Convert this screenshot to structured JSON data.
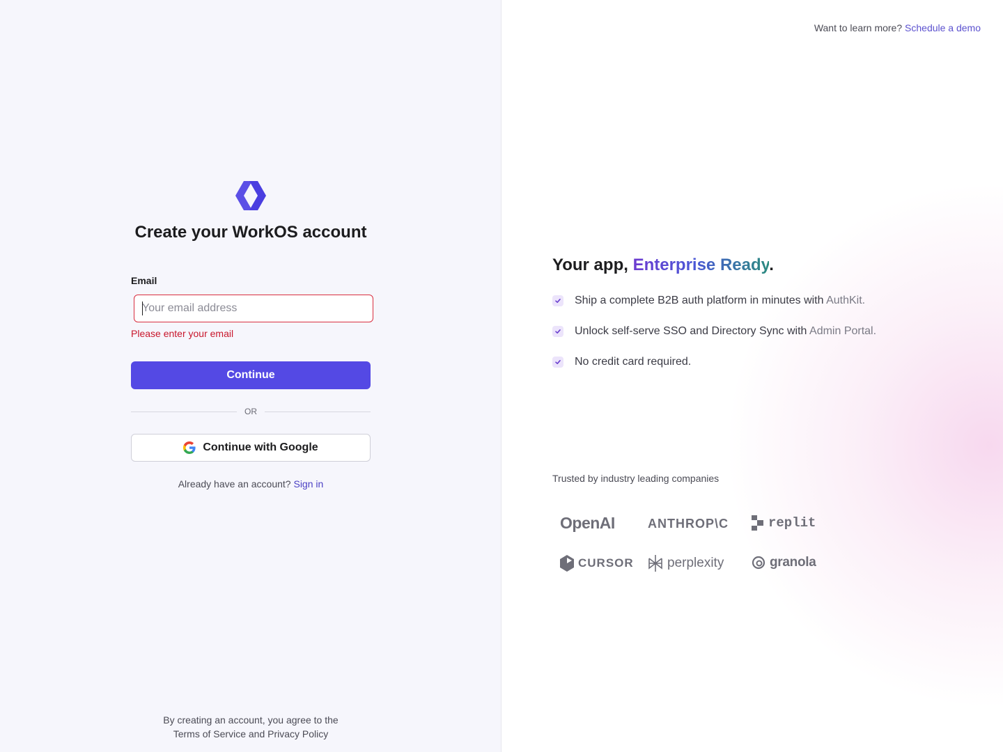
{
  "signup": {
    "title": "Create your WorkOS account",
    "email_label": "Email",
    "email_placeholder": "Your email address",
    "email_value": "",
    "error_message": "Please enter your email",
    "continue_label": "Continue",
    "divider_label": "OR",
    "google_label": "Continue with Google",
    "signin_prompt": "Already have an account?",
    "signin_link": "Sign in",
    "legal_line1": "By creating an account, you agree to the",
    "legal_line2": "Terms of Service and Privacy Policy"
  },
  "marketing": {
    "demo_prompt": "Want to learn more?",
    "demo_link": "Schedule a demo",
    "headline_prefix": "Your app, ",
    "headline_highlight": "Enterprise Ready",
    "headline_suffix": ".",
    "features": [
      {
        "text": "Ship a complete B2B auth platform in minutes with ",
        "muted": "AuthKit."
      },
      {
        "text": "Unlock self-serve SSO and Directory Sync with ",
        "muted": "Admin Portal."
      },
      {
        "text": "No credit card required.",
        "muted": ""
      }
    ],
    "trusted_label": "Trusted by industry leading companies",
    "companies": [
      "OpenAI",
      "ANTHROP\\C",
      "replit",
      "CURSOR",
      "perplexity",
      "granola"
    ]
  },
  "colors": {
    "primary": "#5449e4",
    "error": "#c8162b",
    "link": "#4a3fc4",
    "left_bg": "#f6f6fc"
  },
  "icons": {
    "brand": "workos-logo-icon",
    "google": "google-icon",
    "check": "check-icon"
  }
}
